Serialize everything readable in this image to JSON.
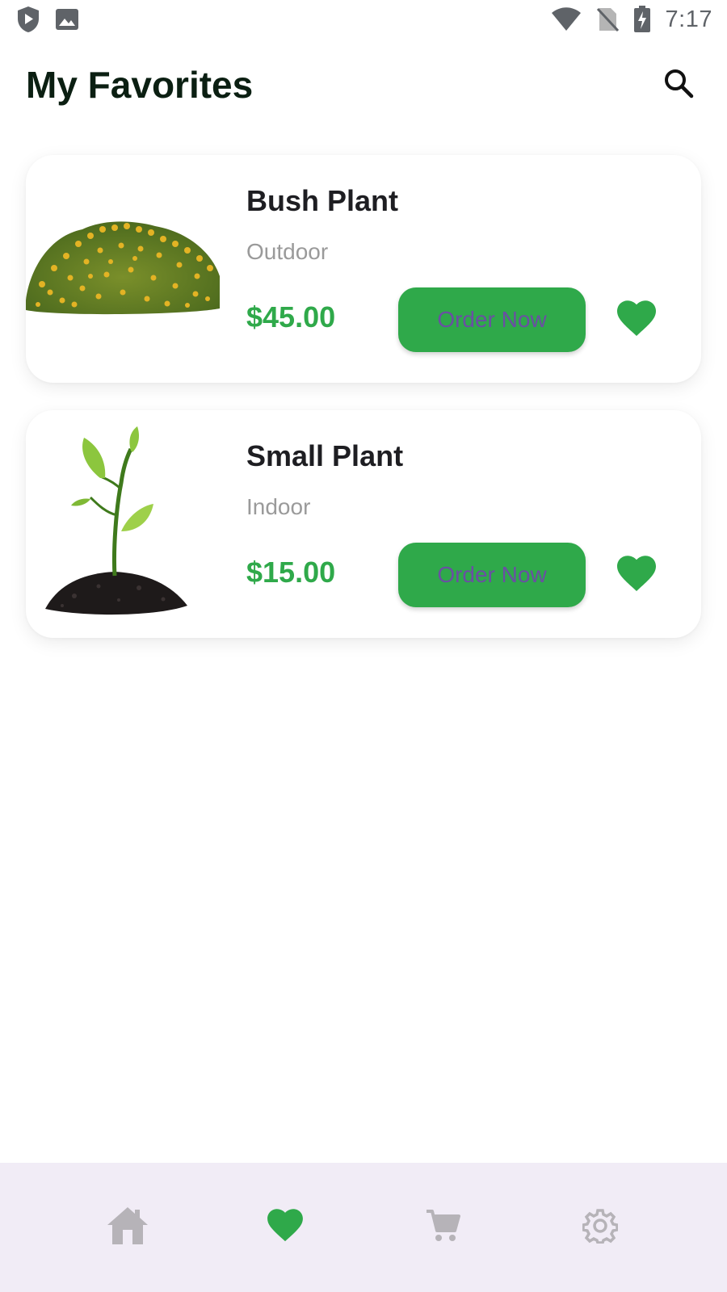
{
  "status_bar": {
    "time": "7:17",
    "icons": [
      "play-shield-icon",
      "image-icon",
      "wifi-icon",
      "no-sim-icon",
      "battery-charging-icon"
    ]
  },
  "header": {
    "title": "My Favorites",
    "search_icon": "search-icon"
  },
  "favorites": [
    {
      "name": "Bush Plant",
      "category": "Outdoor",
      "price": "$45.00",
      "button_label": "Order Now",
      "image": "bush-plant-image",
      "favorited": true
    },
    {
      "name": "Small Plant",
      "category": "Indoor",
      "price": "$15.00",
      "button_label": "Order Now",
      "image": "small-plant-image",
      "favorited": true
    }
  ],
  "bottom_nav": {
    "items": [
      {
        "icon": "home-icon",
        "active": false
      },
      {
        "icon": "heart-icon",
        "active": true
      },
      {
        "icon": "cart-icon",
        "active": false
      },
      {
        "icon": "settings-icon",
        "active": false
      }
    ]
  },
  "colors": {
    "accent": "#2fa94a",
    "title": "#0b1f12",
    "button_text": "#6a4fa3",
    "nav_background": "#f1ecf6",
    "nav_inactive": "#b6b3b8"
  }
}
